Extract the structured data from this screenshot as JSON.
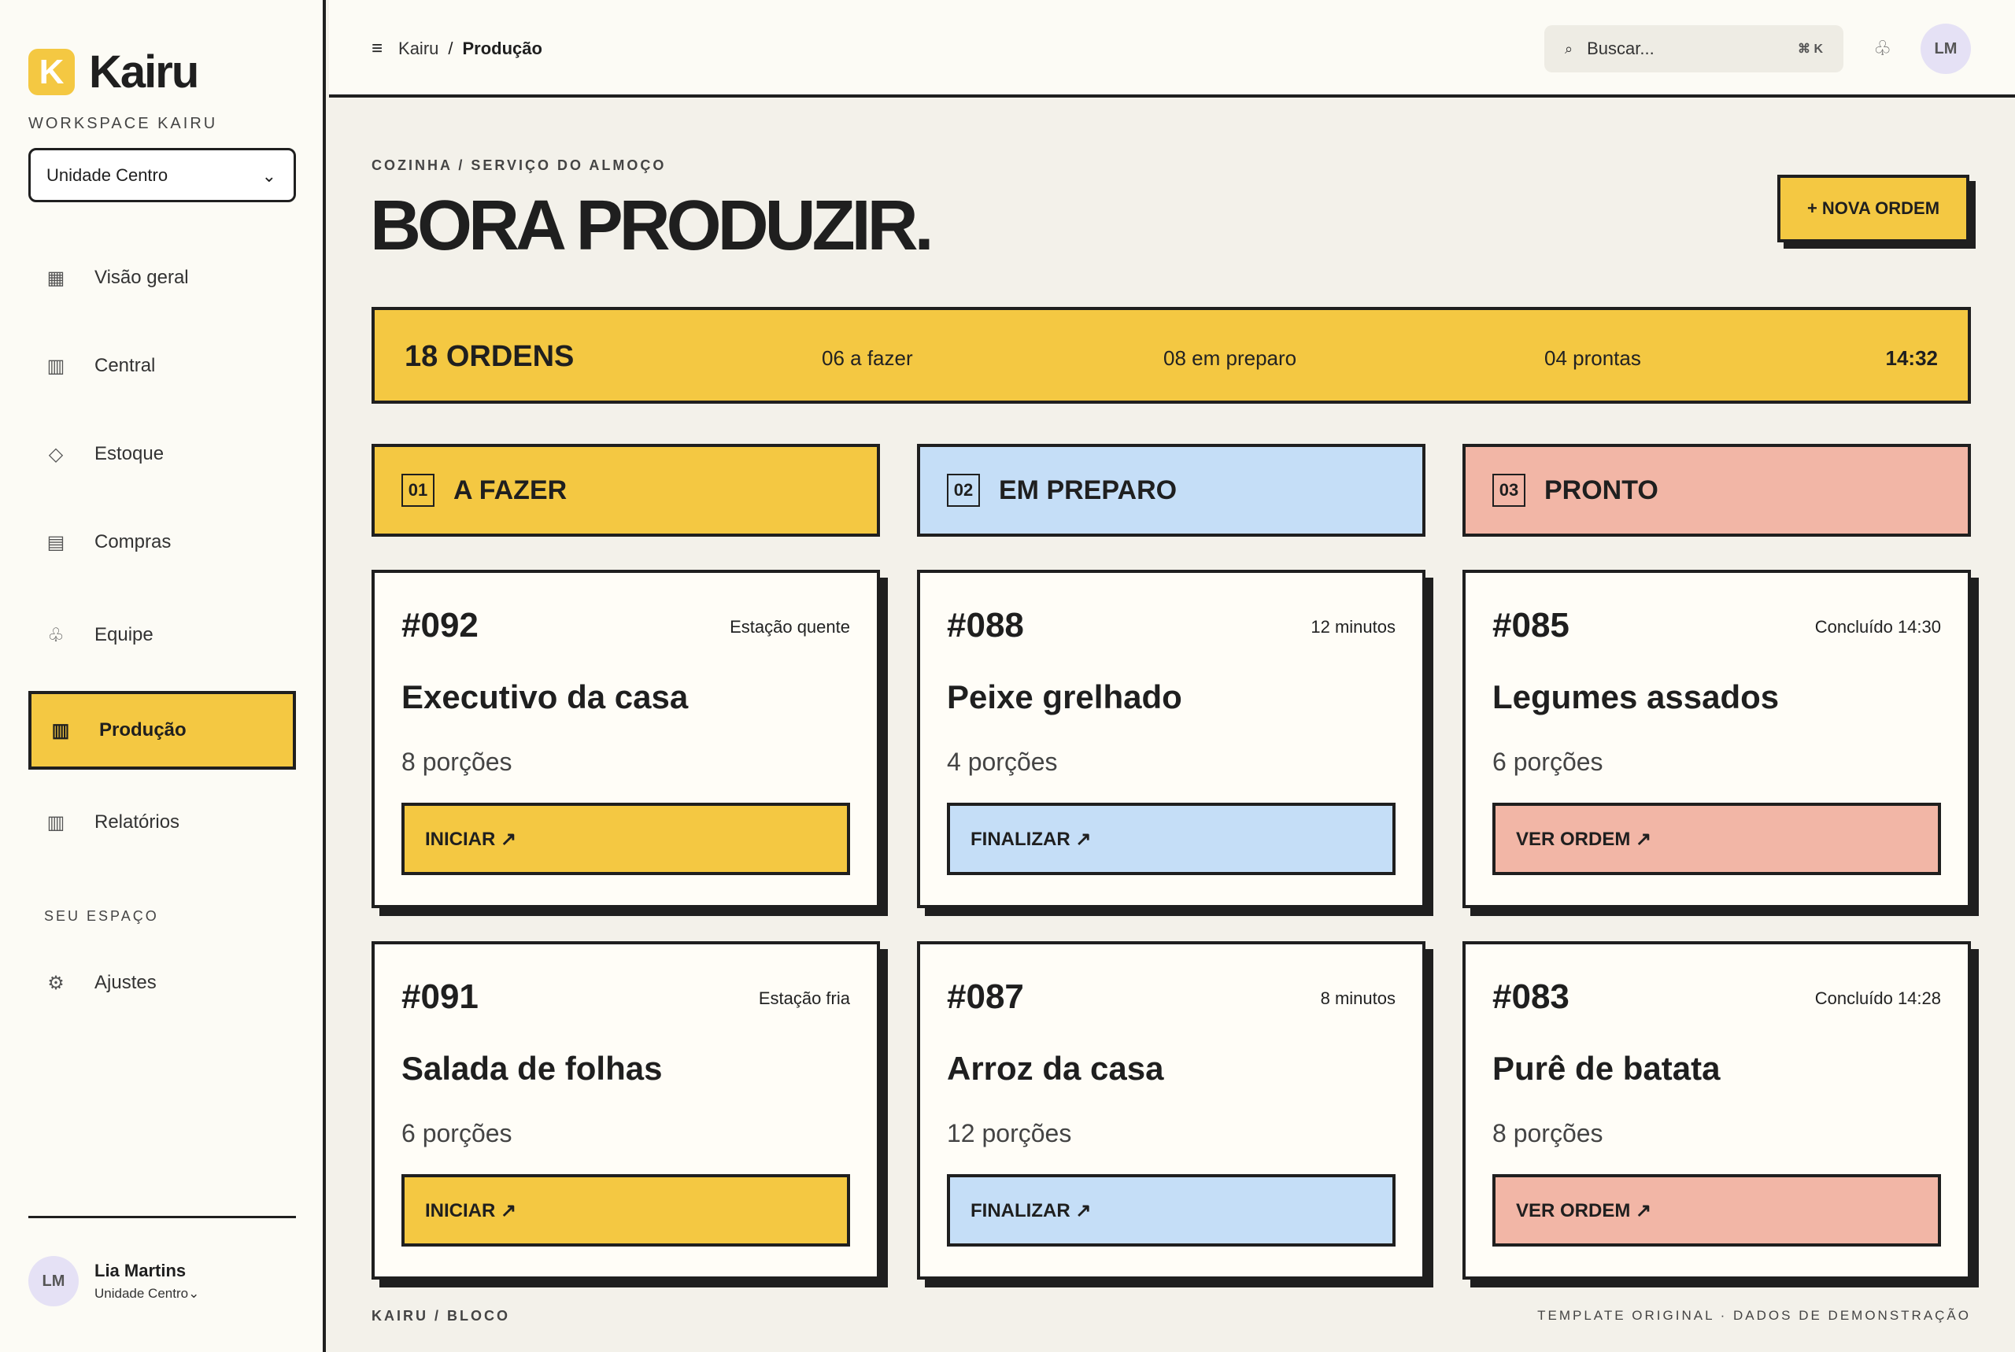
{
  "brand": {
    "logo_letter": "K",
    "name": "Kairu",
    "accent": "#f4c842"
  },
  "sidebar": {
    "workspace_label": "WORKSPACE KAIRU",
    "unit_select": {
      "value": "Unidade Centro",
      "chevron": "chevron-down-icon"
    },
    "items": [
      {
        "label": "Visão geral",
        "icon": "grid-icon"
      },
      {
        "label": "Central",
        "icon": "columns-icon"
      },
      {
        "label": "Estoque",
        "icon": "diamond-icon"
      },
      {
        "label": "Compras",
        "icon": "list-icon"
      },
      {
        "label": "Equipe",
        "icon": "club-icon"
      },
      {
        "label": "Produção",
        "icon": "barcode-icon",
        "active": true
      },
      {
        "label": "Relatórios",
        "icon": "chart-icon"
      }
    ],
    "section_label": "SEU ESPAÇO",
    "settings": {
      "label": "Ajustes",
      "icon": "gear-icon"
    },
    "profile": {
      "initials": "LM",
      "name": "Lia Martins",
      "unit": "Unidade Centro⌄"
    }
  },
  "topbar": {
    "breadcrumb": {
      "root": "Kairu",
      "separator": "/",
      "current": "Produção"
    },
    "search": {
      "placeholder": "Buscar...",
      "shortcut": "⌘ K"
    },
    "avatar_initials": "LM"
  },
  "main": {
    "eyebrow": "COZINHA / SERVIÇO DO ALMOÇO",
    "title": "BORA PRODUZIR.",
    "new_order_label": "+ NOVA ORDEM",
    "summary": {
      "total": "18 ORDENS",
      "todo": "06 a fazer",
      "in_progress": "08 em preparo",
      "ready": "04 prontas",
      "time": "14:32"
    },
    "columns": [
      {
        "number": "01",
        "title": "A FAZER",
        "color": "#f4c842"
      },
      {
        "number": "02",
        "title": "EM PREPARO",
        "color": "#c5def7"
      },
      {
        "number": "03",
        "title": "PRONTO",
        "color": "#f2b6a6"
      }
    ],
    "cards": [
      {
        "id": "#092",
        "meta": "Estação quente",
        "dish": "Executivo da casa",
        "portions": "8 porções",
        "action": "INICIAR ↗"
      },
      {
        "id": "#088",
        "meta": "12 minutos",
        "dish": "Peixe grelhado",
        "portions": "4 porções",
        "action": "FINALIZAR ↗"
      },
      {
        "id": "#085",
        "meta": "Concluído 14:30",
        "dish": "Legumes assados",
        "portions": "6 porções",
        "action": "VER ORDEM ↗"
      },
      {
        "id": "#091",
        "meta": "Estação fria",
        "dish": "Salada de folhas",
        "portions": "6 porções",
        "action": "INICIAR ↗"
      },
      {
        "id": "#087",
        "meta": "8 minutos",
        "dish": "Arroz da casa",
        "portions": "12 porções",
        "action": "FINALIZAR ↗"
      },
      {
        "id": "#083",
        "meta": "Concluído 14:28",
        "dish": "Purê de batata",
        "portions": "8 porções",
        "action": "VER ORDEM ↗"
      }
    ]
  },
  "footer": {
    "left": "KAIRU / BLOCO",
    "right": "TEMPLATE ORIGINAL · DADOS DE DEMONSTRAÇÃO"
  }
}
